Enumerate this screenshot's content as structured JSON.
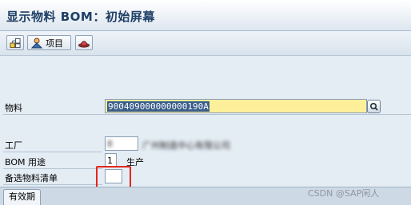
{
  "window": {
    "title": "显示物料 BOM：初始屏幕"
  },
  "toolbar": {
    "buttons": [
      {
        "name": "hierarchy-button",
        "icon": "hierarchy-icon",
        "label": ""
      },
      {
        "name": "items-button",
        "icon": "user-items-icon",
        "label": "项目"
      },
      {
        "name": "hat-button",
        "icon": "hat-icon",
        "label": ""
      }
    ]
  },
  "form": {
    "material": {
      "label": "物料",
      "value": "900409000000000190A"
    },
    "plant": {
      "label": "工厂",
      "value": "8",
      "desc": "广州制造中心有限公司"
    },
    "bom_usage": {
      "label": "BOM 用途",
      "value": "1",
      "desc": "生产"
    },
    "alt_bom": {
      "label": "备选物料清单",
      "value": ""
    }
  },
  "tabs": [
    {
      "label": "有效期"
    }
  ],
  "watermark": "CSDN @SAP闲人",
  "colors": {
    "required_field": "#fef09b",
    "highlight_box": "#e0271f",
    "title_text": "#1f3f66"
  }
}
